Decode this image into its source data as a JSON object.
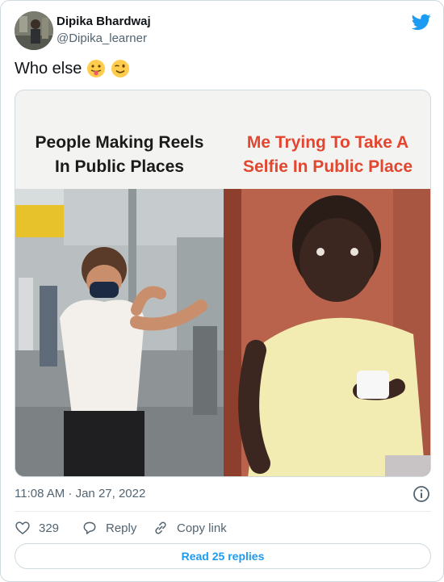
{
  "author": {
    "name": "Dipika Bhardwaj",
    "handle": "@Dipika_learner"
  },
  "tweet": {
    "text": "Who else",
    "emojis": [
      "tongue-out-emoji",
      "winking-emoji"
    ]
  },
  "media": {
    "left_caption": [
      "People Making Reels",
      "In Public Places"
    ],
    "right_caption": [
      "Me Trying To Take A",
      "Selfie In Public Place"
    ],
    "colors": {
      "left_caption": "#1a1a1a",
      "right_caption": "#e2462f"
    }
  },
  "meta": {
    "timestamp": "11:08 AM · Jan 27, 2022"
  },
  "actions": {
    "like_count": "329",
    "reply_label": "Reply",
    "copy_label": "Copy link"
  },
  "read_replies": "Read 25 replies",
  "colors": {
    "accent": "#1d9bf0",
    "secondary_text": "#536471",
    "border": "#cfd9de"
  }
}
